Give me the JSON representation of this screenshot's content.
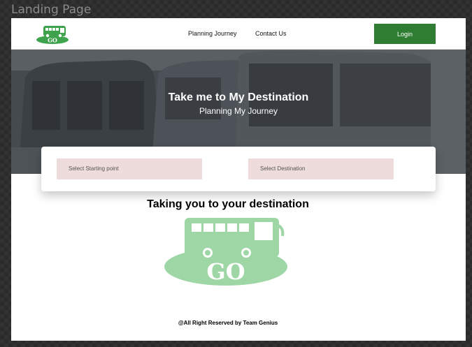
{
  "frame_label": "Landing Page",
  "nav": {
    "logo_text": "GO",
    "planning_link": "Planning Journey",
    "contact_link": "Contact Us",
    "login_label": "Login"
  },
  "hero": {
    "title": "Take me to My Destination",
    "subtitle": "Planning My Journey"
  },
  "search": {
    "start_placeholder": "Select Starting point",
    "destination_placeholder": "Select Destination"
  },
  "tagline": "Taking you to your destination",
  "logo_text": "GO",
  "footer": "@All Right Reserved by Team Genius",
  "colors": {
    "brand_green": "#2e7d32",
    "logo_green": "#3fa34d",
    "logo_light_green": "#9ed6a6",
    "select_bg": "#eedcdc"
  }
}
